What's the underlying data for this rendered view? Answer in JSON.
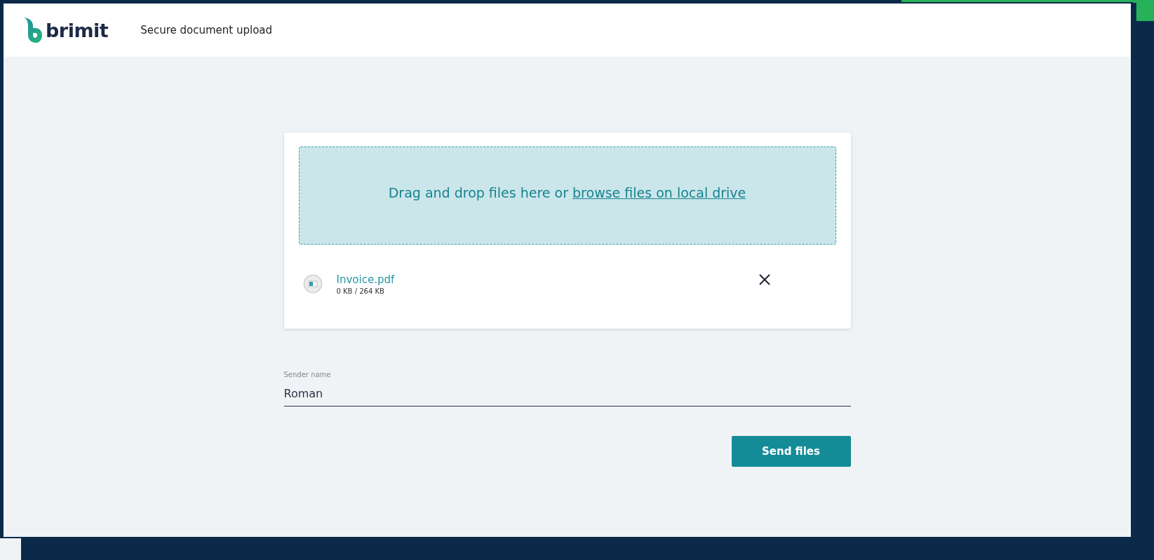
{
  "header": {
    "logo_text": "brimit",
    "title": "Secure document upload"
  },
  "dropzone": {
    "text": "Drag and drop files here or",
    "link": "browse files on local drive"
  },
  "files": [
    {
      "name": "Invoice.pdf",
      "progress": "0 KB / 264 KB"
    }
  ],
  "sender_field": {
    "label": "Sender name",
    "value": "Roman"
  },
  "buttons": [
    {
      "label": "Send files"
    }
  ]
}
